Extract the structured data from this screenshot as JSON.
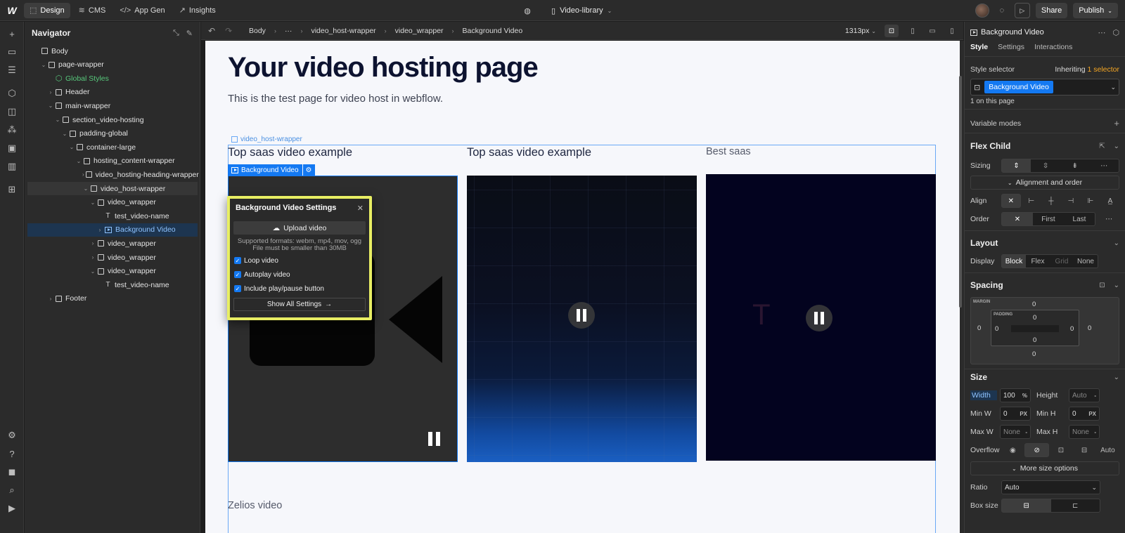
{
  "topbar": {
    "logo": "W",
    "tabs": [
      {
        "label": "Design",
        "icon": "design-icon",
        "active": true
      },
      {
        "label": "CMS",
        "icon": "database-icon"
      },
      {
        "label": "App Gen",
        "icon": "code-icon"
      },
      {
        "label": "Insights",
        "icon": "chart-icon"
      }
    ],
    "page_name": "Video-library",
    "share_label": "Share",
    "publish_label": "Publish"
  },
  "navigator": {
    "title": "Navigator",
    "tree": [
      {
        "label": "Body",
        "depth": 0,
        "chevron": "",
        "kind": "box"
      },
      {
        "label": "page-wrapper",
        "depth": 1,
        "chevron": "v",
        "kind": "box"
      },
      {
        "label": "Global Styles",
        "depth": 2,
        "chevron": "",
        "kind": "global"
      },
      {
        "label": "Header",
        "depth": 2,
        "chevron": ">",
        "kind": "box"
      },
      {
        "label": "main-wrapper",
        "depth": 2,
        "chevron": "v",
        "kind": "box"
      },
      {
        "label": "section_video-hosting",
        "depth": 3,
        "chevron": "v",
        "kind": "box"
      },
      {
        "label": "padding-global",
        "depth": 4,
        "chevron": "v",
        "kind": "box"
      },
      {
        "label": "container-large",
        "depth": 5,
        "chevron": "v",
        "kind": "box"
      },
      {
        "label": "hosting_content-wrapper",
        "depth": 6,
        "chevron": "v",
        "kind": "box"
      },
      {
        "label": "video_hosting-heading-wrapper",
        "depth": 7,
        "chevron": ">",
        "kind": "box"
      },
      {
        "label": "video_host-wrapper",
        "depth": 7,
        "chevron": "v",
        "kind": "box",
        "highlight": true
      },
      {
        "label": "video_wrapper",
        "depth": 8,
        "chevron": "v",
        "kind": "box"
      },
      {
        "label": "test_video-name",
        "depth": 9,
        "chevron": "",
        "kind": "text"
      },
      {
        "label": "Background Video",
        "depth": 9,
        "chevron": ">",
        "kind": "video",
        "selected": true
      },
      {
        "label": "video_wrapper",
        "depth": 8,
        "chevron": ">",
        "kind": "box"
      },
      {
        "label": "video_wrapper",
        "depth": 8,
        "chevron": ">",
        "kind": "box"
      },
      {
        "label": "video_wrapper",
        "depth": 8,
        "chevron": "v",
        "kind": "box"
      },
      {
        "label": "test_video-name",
        "depth": 9,
        "chevron": "",
        "kind": "text"
      },
      {
        "label": "Footer",
        "depth": 2,
        "chevron": ">",
        "kind": "box"
      }
    ]
  },
  "canvas_bar": {
    "breadcrumbs": [
      "Body",
      "···",
      "video_host-wrapper",
      "video_wrapper",
      "Background Video"
    ],
    "breakpoint": "1313px"
  },
  "page": {
    "heading": "Your video hosting page",
    "subheading": "This is the test page for video host in webflow.",
    "wrapper_tag": "video_host-wrapper",
    "col_titles": [
      "Top saas video example",
      "Top saas video example",
      "Best saas"
    ],
    "selection_label": "Background Video",
    "ghost_letter": "T",
    "bottom_title": "Zelios video"
  },
  "popup": {
    "title": "Background Video Settings",
    "upload_label": "Upload video",
    "formats_line1": "Supported formats: webm, mp4, mov, ogg",
    "formats_line2": "File must be smaller than 30MB",
    "options": [
      {
        "label": "Loop video",
        "checked": true
      },
      {
        "label": "Autoplay video",
        "checked": true
      },
      {
        "label": "Include play/pause button",
        "checked": true
      }
    ],
    "show_all_label": "Show All Settings"
  },
  "right_panel": {
    "element_name": "Background Video",
    "tabs": [
      "Style",
      "Settings",
      "Interactions"
    ],
    "style_selector_label": "Style selector",
    "inheriting_label": "Inheriting",
    "inheriting_count": "1 selector",
    "selector_chip": "Background Video",
    "on_page": "1 on this page",
    "variable_modes": "Variable modes",
    "flex_child": "Flex Child",
    "sizing_label": "Sizing",
    "alignment_order": "Alignment and order",
    "align_label": "Align",
    "order_label": "Order",
    "order_options": [
      "First",
      "Last"
    ],
    "layout": "Layout",
    "display_label": "Display",
    "display_options": [
      "Block",
      "Flex",
      "Grid",
      "None"
    ],
    "spacing": "Spacing",
    "margin_label": "MARGIN",
    "padding_label": "PADDING",
    "margin": {
      "top": "0",
      "right": "0",
      "bottom": "0",
      "left": "0"
    },
    "padding": {
      "top": "0",
      "right": "0",
      "bottom": "0",
      "left": "0"
    },
    "size": "Size",
    "width_label": "Width",
    "width_value": "100",
    "width_unit": "%",
    "height_label": "Height",
    "height_value": "Auto",
    "minw_label": "Min W",
    "minw_value": "0",
    "minh_label": "Min H",
    "minh_value": "0",
    "px_unit": "PX",
    "maxw_label": "Max W",
    "maxw_value": "None",
    "maxh_label": "Max H",
    "maxh_value": "None",
    "overflow_label": "Overflow",
    "overflow_auto": "Auto",
    "more_size": "More size options",
    "ratio_label": "Ratio",
    "ratio_value": "Auto",
    "box_size_label": "Box size"
  }
}
